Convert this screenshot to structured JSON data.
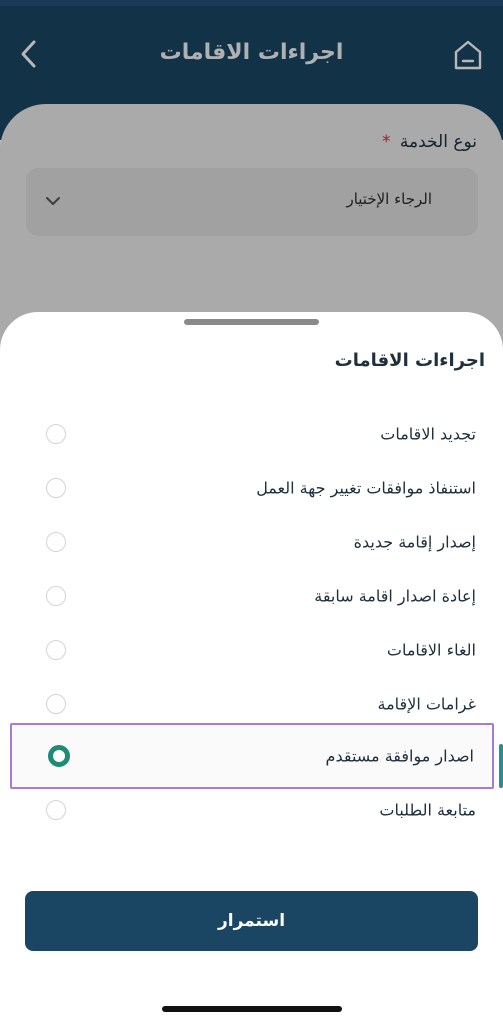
{
  "header": {
    "title": "اجراءات الاقامات",
    "back_icon": "chevron-left-icon",
    "home_icon": "home-icon"
  },
  "form": {
    "service_type_label": "نوع الخدمة",
    "required_mark": "*",
    "select_placeholder": "الرجاء الإختيار"
  },
  "sheet": {
    "title": "اجراءات الاقامات",
    "options": [
      {
        "label": "تجديد الاقامات",
        "selected": false
      },
      {
        "label": "استنفاذ موافقات تغيير جهة العمل",
        "selected": false
      },
      {
        "label": "إصدار إقامة جديدة",
        "selected": false
      },
      {
        "label": "إعادة اصدار اقامة سابقة",
        "selected": false
      },
      {
        "label": "الغاء الاقامات",
        "selected": false
      },
      {
        "label": "غرامات الإقامة",
        "selected": false
      },
      {
        "label": "اصدار موافقة مستقدم",
        "selected": true
      },
      {
        "label": "متابعة الطلبات",
        "selected": false
      }
    ],
    "continue_label": "استمرار"
  },
  "colors": {
    "primary": "#1a4663",
    "selected_radio": "#1e8c74",
    "selection_outline": "#a77bd8",
    "required": "#d9342b"
  }
}
